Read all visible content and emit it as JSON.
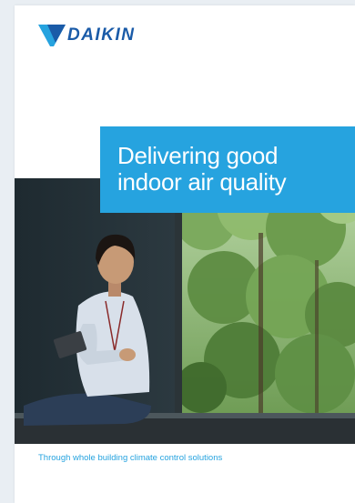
{
  "brand": {
    "name": "DAIKIN",
    "color": "#1a5ba8"
  },
  "cover": {
    "title_line_1": "Delivering good",
    "title_line_2": "indoor air quality",
    "subtitle": "Through whole building climate control solutions",
    "accent_color": "#26a3df"
  },
  "photo": {
    "icon": "person-with-tablet-by-window-photo"
  }
}
